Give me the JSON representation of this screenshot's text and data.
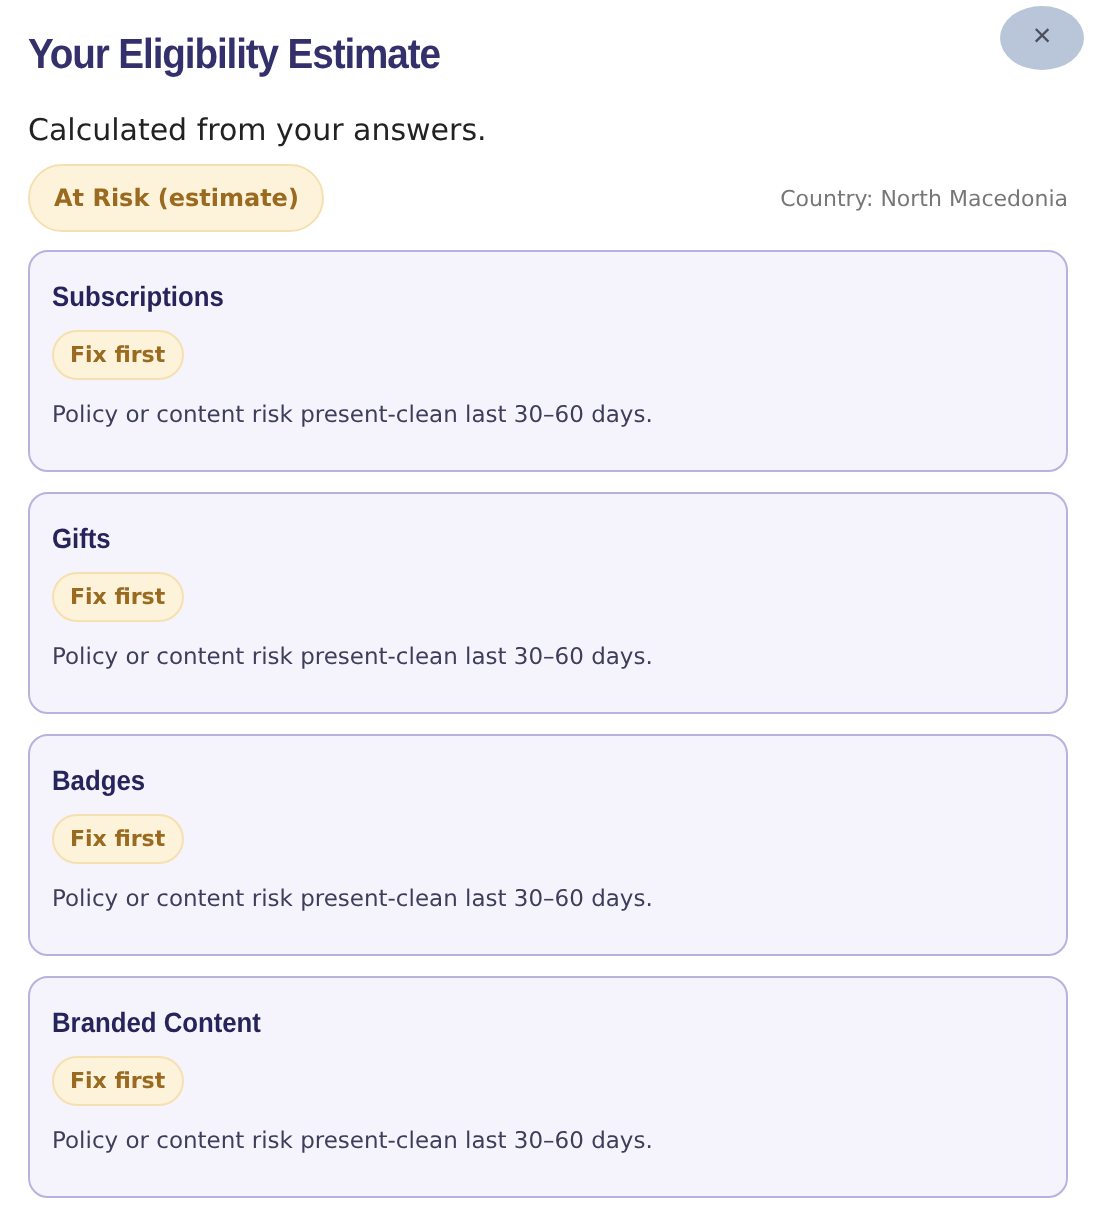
{
  "dialog": {
    "title": "Your Eligibility Estimate",
    "close": "×",
    "subtitle": "Calculated from your answers.",
    "status": "At Risk (estimate)",
    "country": "Country: North Macedonia"
  },
  "categories": [
    {
      "name": "Subscriptions",
      "badge": "Fix first",
      "note": "Policy or content risk present-clean last 30–60 days."
    },
    {
      "name": "Gifts",
      "badge": "Fix first",
      "note": "Policy or content risk present-clean last 30–60 days."
    },
    {
      "name": "Badges",
      "badge": "Fix first",
      "note": "Policy or content risk present-clean last 30–60 days."
    },
    {
      "name": "Branded Content",
      "badge": "Fix first",
      "note": "Policy or content risk present-clean last 30–60 days."
    }
  ]
}
